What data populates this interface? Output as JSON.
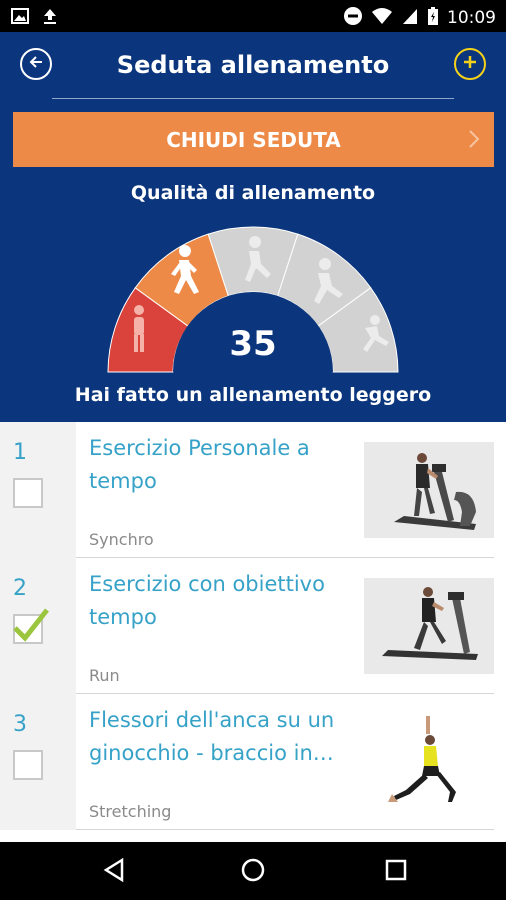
{
  "status_bar": {
    "time": "10:09",
    "left_icons": [
      "image-icon",
      "upload-icon"
    ],
    "right_icons": [
      "do-not-disturb-icon",
      "wifi-icon",
      "signal-icon",
      "battery-icon"
    ]
  },
  "header": {
    "title": "Seduta allenamento",
    "back_icon": "back-arrow-icon",
    "add_icon": "plus-icon",
    "close_session_label": "CHIUDI SEDUTA"
  },
  "quality": {
    "label": "Qualità di allenamento",
    "value": "35",
    "message": "Hai fatto un allenamento leggero",
    "level_fraction": 0.35,
    "segments": [
      "standing",
      "walking",
      "running",
      "running-fast",
      "sprinting"
    ],
    "colors": {
      "red": "#d9433b",
      "orange": "#ee8a47",
      "grey": "#d2d2d2",
      "navy": "#0b357c"
    }
  },
  "exercises": [
    {
      "number": "1",
      "title": "Esercizio Personale a tempo",
      "type": "Synchro",
      "checked": false,
      "image": "elliptical-trainer-image"
    },
    {
      "number": "2",
      "title": "Esercizio con obiettivo tempo",
      "type": "Run",
      "checked": true,
      "image": "treadmill-image"
    },
    {
      "number": "3",
      "title": "Flessori dell'anca su un ginocchio - braccio in…",
      "type": "Stretching",
      "checked": false,
      "image": "stretching-lunge-image"
    }
  ],
  "navigation": [
    "back-triangle-icon",
    "home-circle-icon",
    "recents-square-icon"
  ],
  "accent": {
    "blue_text": "#36a2c8",
    "check_green": "#9bc53d",
    "add_yellow": "#f5d21a"
  }
}
